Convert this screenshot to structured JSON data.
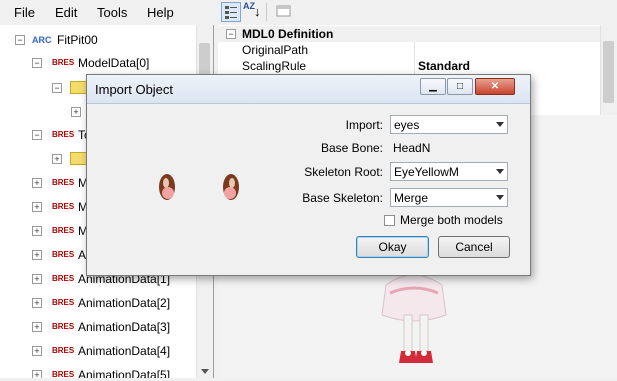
{
  "menu": {
    "file": "File",
    "edit": "Edit",
    "tools": "Tools",
    "help": "Help"
  },
  "toolbar": {
    "sort_az": "AZ",
    "sort_arrow": "↓"
  },
  "tree": {
    "root": {
      "badge": "ARC",
      "label": "FitPit00",
      "expander": "−"
    },
    "items": [
      {
        "badge": "BRES",
        "label": "ModelData[0]",
        "expander": "−"
      },
      {
        "badge": "",
        "label": "",
        "expander": "−"
      },
      {
        "badge": "",
        "label": "",
        "expander": "+"
      },
      {
        "badge": "BRES",
        "label": "To",
        "expander": "−"
      },
      {
        "badge": "",
        "label": "",
        "expander": "+"
      },
      {
        "badge": "BRES",
        "label": "M",
        "expander": "+"
      },
      {
        "badge": "BRES",
        "label": "M",
        "expander": "+"
      },
      {
        "badge": "BRES",
        "label": "M",
        "expander": "+"
      },
      {
        "badge": "BRES",
        "label": "A",
        "expander": "+"
      },
      {
        "badge": "BRES",
        "label": "AnimationData[1]",
        "expander": "+"
      },
      {
        "badge": "BRES",
        "label": "AnimationData[2]",
        "expander": "+"
      },
      {
        "badge": "BRES",
        "label": "AnimationData[3]",
        "expander": "+"
      },
      {
        "badge": "BRES",
        "label": "AnimationData[4]",
        "expander": "+"
      },
      {
        "badge": "BRES",
        "label": "AnimationData[5]",
        "expander": "+"
      }
    ]
  },
  "properties": {
    "category": "MDL0 Definition",
    "rows": [
      {
        "name": "OriginalPath",
        "value": ""
      },
      {
        "name": "ScalingRule",
        "value": "Standard"
      }
    ]
  },
  "dialog": {
    "title": "Import Object",
    "import_label": "Import:",
    "import_value": "eyes",
    "base_bone_label": "Base Bone:",
    "base_bone_value": "HeadN",
    "skeleton_root_label": "Skeleton Root:",
    "skeleton_root_value": "EyeYellowM",
    "base_skeleton_label": "Base Skeleton:",
    "base_skeleton_value": "Merge",
    "merge_both_label": "Merge both models",
    "merge_both_checked": false,
    "okay_label": "Okay",
    "cancel_label": "Cancel"
  },
  "colors": {
    "accent": "#3c7fb1",
    "bres": "#b00000",
    "arc": "#3366cc",
    "folder": "#f3dc6b"
  }
}
